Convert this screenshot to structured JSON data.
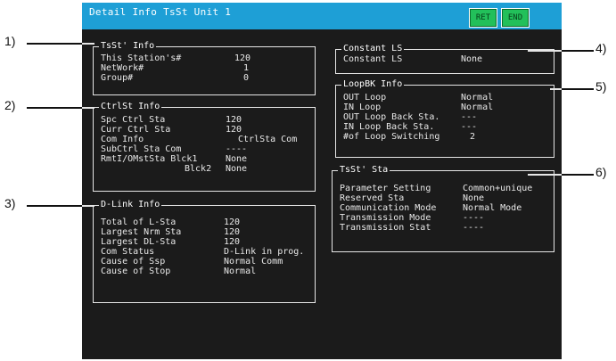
{
  "window": {
    "title": "Detail Info TsSt Unit  1"
  },
  "buttons": {
    "ret": "RET",
    "end": "END"
  },
  "callouts": [
    "1)",
    "2)",
    "3)",
    "4)",
    "5)",
    "6)"
  ],
  "tsst_info": {
    "title": "TsSt' Info",
    "rows": [
      {
        "label": "This Station's#",
        "value": "120"
      },
      {
        "label": "NetWork#",
        "value": "1"
      },
      {
        "label": "Group#",
        "value": "0"
      }
    ]
  },
  "ctrlst_info": {
    "title": "CtrlSt Info",
    "rows": [
      {
        "label": "Spc Ctrl Sta",
        "value": "120"
      },
      {
        "label": "Curr Ctrl Sta",
        "value": "120"
      },
      {
        "label": "Com Info",
        "value": "CtrlSta Com"
      },
      {
        "label": "SubCtrl Sta Com",
        "value": "----"
      },
      {
        "label": "RmtI/OMstSta Blck1",
        "value": "None"
      },
      {
        "label": "Blck2",
        "value": "None"
      }
    ]
  },
  "dlink_info": {
    "title": "D-Link Info",
    "rows": [
      {
        "label": "Total of L-Sta",
        "value": "120"
      },
      {
        "label": "Largest Nrm Sta",
        "value": "120"
      },
      {
        "label": "Largest DL-Sta",
        "value": "120"
      },
      {
        "label": "Com Status",
        "value": "D-Link in prog."
      },
      {
        "label": "Cause of Ssp",
        "value": "Normal Comm"
      },
      {
        "label": "Cause of Stop",
        "value": "Normal"
      }
    ]
  },
  "constant_ls": {
    "title": "Constant LS",
    "rows": [
      {
        "label": "Constant LS",
        "value": "None"
      }
    ]
  },
  "loopbk_info": {
    "title": "LoopBK Info",
    "rows": [
      {
        "label": "OUT Loop",
        "value": "Normal"
      },
      {
        "label": "IN Loop",
        "value": "Normal"
      },
      {
        "label": "OUT Loop Back Sta.",
        "value": "---"
      },
      {
        "label": "IN Loop Back Sta.",
        "value": "---"
      },
      {
        "label": "#of Loop Switching",
        "value": "2"
      }
    ]
  },
  "tsst_sta": {
    "title": "TsSt' Sta",
    "rows": [
      {
        "label": "Parameter Setting",
        "value": "Common+unique"
      },
      {
        "label": "Reserved Sta",
        "value": "None"
      },
      {
        "label": "Communication Mode",
        "value": "Normal Mode"
      },
      {
        "label": "Transmission Mode",
        "value": "----"
      },
      {
        "label": "Transmission Stat",
        "value": "----"
      }
    ]
  }
}
